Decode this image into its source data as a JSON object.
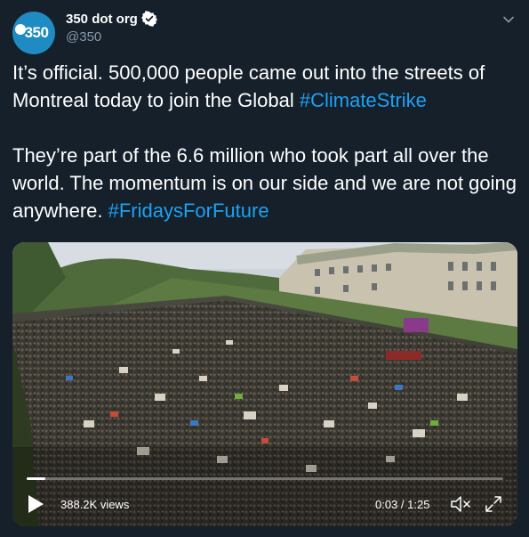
{
  "author": {
    "avatar_text": "350",
    "name": "350 dot org",
    "handle": "@350"
  },
  "tweet": {
    "para1_text": "It’s official. 500,000 people came out into the streets of Montreal today to join the Global ",
    "para1_hashtag": "#ClimateStrike",
    "para2_text": "They’re part of the 6.6 million who took part all over the world. The momentum is on our side and we are not going anywhere. ",
    "para2_hashtag": "#FridaysForFuture"
  },
  "video": {
    "views": "388.2K views",
    "time": "0:03 / 1:25",
    "progress": 0.04
  },
  "colors": {
    "background": "#15202b",
    "link": "#1da1f2",
    "secondary_text": "#8899a6",
    "avatar": "#1e8bc3"
  },
  "icons": [
    "verified-badge-icon",
    "chevron-down-icon",
    "play-icon",
    "mute-icon",
    "expand-icon"
  ]
}
